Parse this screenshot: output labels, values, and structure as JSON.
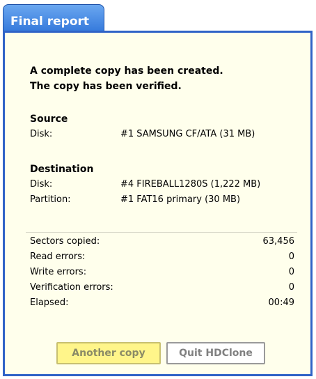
{
  "tab": {
    "title": "Final report"
  },
  "status": {
    "line1": "A complete copy has been created.",
    "line2": "The copy has been verified."
  },
  "source": {
    "title": "Source",
    "disk_label": "Disk:",
    "disk_value": "#1 SAMSUNG CF/ATA (31 MB)"
  },
  "destination": {
    "title": "Destination",
    "disk_label": "Disk:",
    "disk_value": "#4 FIREBALL1280S (1,222 MB)",
    "partition_label": "Partition:",
    "partition_value": "#1 FAT16 primary (30 MB)"
  },
  "stats": [
    {
      "label": "Sectors copied:",
      "value": "63,456"
    },
    {
      "label": "Read errors:",
      "value": "0"
    },
    {
      "label": "Write errors:",
      "value": "0"
    },
    {
      "label": "Verification errors:",
      "value": "0"
    },
    {
      "label": "Elapsed:",
      "value": "00:49"
    }
  ],
  "buttons": {
    "another_copy": "Another copy",
    "quit": "Quit HDClone"
  },
  "colors": {
    "tab": "#2f74d9",
    "panel_border": "#2f63c7",
    "panel_bg": "#ffffec",
    "primary_button": "#fff58a"
  }
}
